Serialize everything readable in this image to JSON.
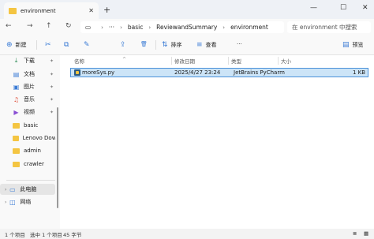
{
  "window": {
    "tab_title": "environment",
    "tab_close": "✕",
    "new_tab": "+",
    "minimize": "—",
    "maximize": "☐",
    "close": "✕"
  },
  "navigation": {
    "back": "←",
    "forward": "→",
    "up": "↑",
    "refresh": "↻",
    "pc_icon": "▭",
    "breadcrumb": [
      "···",
      "basic",
      "ReviewandSummary",
      "environment"
    ],
    "search_placeholder": "在 environment 中搜索"
  },
  "toolbar": {
    "new_label": "新建",
    "new_icon": "⊕",
    "cut_icon": "✂",
    "copy_icon": "⧉",
    "rename_icon": "✎",
    "share_icon": "⇪",
    "delete_icon": "🗑",
    "sort_label": "排序",
    "sort_icon": "⇅",
    "view_label": "查看",
    "view_icon": "≡",
    "more": "···",
    "preview_label": "预览",
    "preview_icon": "▤"
  },
  "sidebar": {
    "items": [
      {
        "label": "下载",
        "icon": "download-icon",
        "glyph": "⤓",
        "pinned": true
      },
      {
        "label": "文档",
        "icon": "document-icon",
        "glyph": "▤",
        "pinned": true
      },
      {
        "label": "图片",
        "icon": "picture-icon",
        "glyph": "▣",
        "pinned": true
      },
      {
        "label": "音乐",
        "icon": "music-icon",
        "glyph": "♫",
        "pinned": true
      },
      {
        "label": "视频",
        "icon": "video-icon",
        "glyph": "▶",
        "pinned": true
      },
      {
        "label": "basic",
        "icon": "folder-icon",
        "pinned": false
      },
      {
        "label": "Lenovo Downl",
        "icon": "folder-icon",
        "pinned": false
      },
      {
        "label": "admin",
        "icon": "folder-icon",
        "pinned": false
      },
      {
        "label": "crawler",
        "icon": "folder-icon",
        "pinned": false
      }
    ],
    "this_pc": "此电脑",
    "network": "网络",
    "pin_glyph": "📌"
  },
  "columns": {
    "name": "名称",
    "date": "修改日期",
    "type": "类型",
    "size": "大小"
  },
  "files": [
    {
      "name": "moreSys.py",
      "date": "2025/4/27 23:24",
      "type": "JetBrains PyCharm",
      "size": "1 KB"
    }
  ],
  "status": {
    "count": "1 个项目",
    "selected": "选中 1 个项目",
    "bytes": "45 字节"
  }
}
